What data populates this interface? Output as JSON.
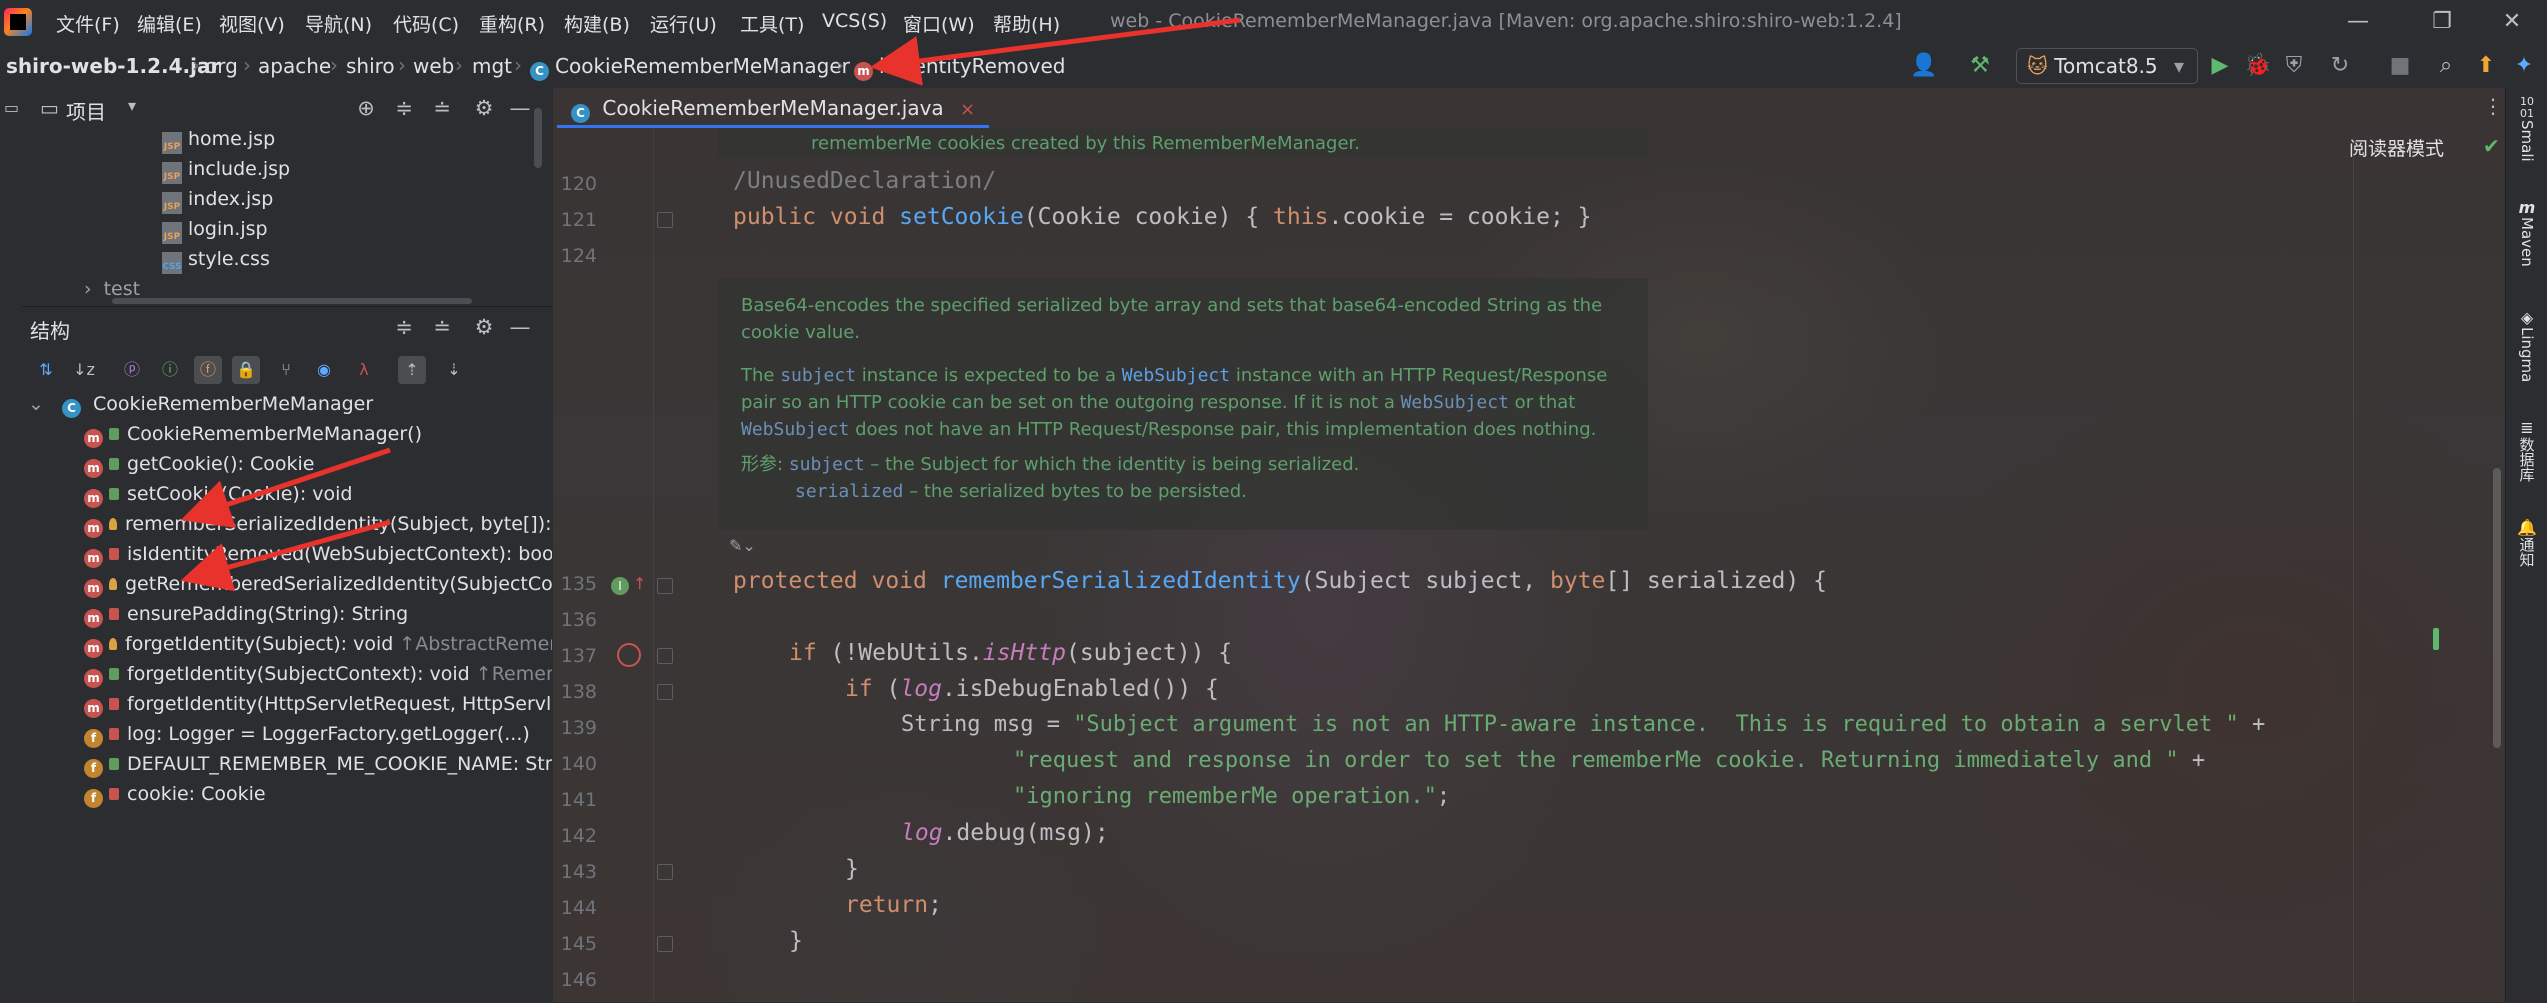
{
  "menu": [
    "文件(F)",
    "编辑(E)",
    "视图(V)",
    "导航(N)",
    "代码(C)",
    "重构(R)",
    "构建(B)",
    "运行(U)",
    "工具(T)",
    "VCS(S)",
    "窗口(W)",
    "帮助(H)"
  ],
  "window_title": "web - CookieRememberMeManager.java [Maven: org.apache.shiro:shiro-web:1.2.4]",
  "window_controls": {
    "minimize": "—",
    "restore": "❐",
    "close": "✕"
  },
  "breadcrumb": [
    "shiro-web-1.2.4.jar",
    "org",
    "apache",
    "shiro",
    "web",
    "mgt",
    "CookieRememberMeManager",
    "isIdentityRemoved"
  ],
  "run_config": "Tomcat8.5",
  "project_panel": {
    "title": "项目",
    "files": [
      {
        "name": "home.jsp",
        "type": "JSP"
      },
      {
        "name": "include.jsp",
        "type": "JSP"
      },
      {
        "name": "index.jsp",
        "type": "JSP"
      },
      {
        "name": "login.jsp",
        "type": "JSP"
      },
      {
        "name": "style.css",
        "type": "CSS"
      }
    ],
    "folder": "test"
  },
  "structure_panel": {
    "title": "结构",
    "root": "CookieRememberMeManager",
    "members": [
      {
        "kind": "m",
        "vis": "pub",
        "text": "CookieRememberMeManager()",
        "suffix": ""
      },
      {
        "kind": "m",
        "vis": "pub",
        "text": "getCookie(): Cookie",
        "suffix": ""
      },
      {
        "kind": "m",
        "vis": "pub",
        "text": "setCookie(Cookie): void",
        "suffix": ""
      },
      {
        "kind": "m",
        "vis": "prot",
        "text": "rememberSerializedIdentity(Subject, byte[]): v",
        "suffix": ""
      },
      {
        "kind": "m",
        "vis": "priv",
        "text": "isIdentityRemoved(WebSubjectContext): bool",
        "suffix": ""
      },
      {
        "kind": "m",
        "vis": "prot",
        "text": "getRememberedSerializedIdentity(SubjectCor",
        "suffix": ""
      },
      {
        "kind": "m",
        "vis": "priv",
        "text": "ensurePadding(String): String",
        "suffix": ""
      },
      {
        "kind": "m",
        "vis": "prot",
        "text": "forgetIdentity(Subject): void",
        "suffix": " ↑AbstractRememb"
      },
      {
        "kind": "m",
        "vis": "pub",
        "text": "forgetIdentity(SubjectContext): void",
        "suffix": " ↑Remem"
      },
      {
        "kind": "m",
        "vis": "priv",
        "text": "forgetIdentity(HttpServletRequest, HttpServle",
        "suffix": ""
      },
      {
        "kind": "f",
        "vis": "priv",
        "text": "log: Logger = LoggerFactory.getLogger(...)",
        "suffix": ""
      },
      {
        "kind": "f",
        "vis": "pub",
        "text": "DEFAULT_REMEMBER_ME_COOKIE_NAME: Str",
        "suffix": ""
      },
      {
        "kind": "f",
        "vis": "priv",
        "text": "cookie: Cookie",
        "suffix": ""
      }
    ]
  },
  "editor": {
    "tab": "CookieRememberMeManager.java",
    "reader_mode": "阅读器模式",
    "top_doc_fragment": "rememberMe cookies created by this RememberMeManager.",
    "doc": {
      "p1": "Base64-encodes the specified serialized byte array and sets that base64-encoded String as the cookie value.",
      "p2_a": "The ",
      "p2_code1": "subject",
      "p2_b": " instance is expected to be a ",
      "p2_link": "WebSubject",
      "p2_c": " instance with an HTTP Request/Response pair so an HTTP cookie can be set on the outgoing response. If it is not a ",
      "p2_code2": "WebSubject",
      "p2_d": " or that ",
      "p2_code3": "WebSubject",
      "p2_e": " does not have an HTTP Request/Response pair, this implementation does nothing.",
      "params_label": "形参:",
      "param1": "subject",
      "param1_desc": " – the Subject for which the identity is being serialized.",
      "param2": "serialized",
      "param2_desc": " – the serialized bytes to be persisted."
    },
    "lines": {
      "n120": "120",
      "n121": "121",
      "n124": "124",
      "n135": "135",
      "n136": "136",
      "n137": "137",
      "n138": "138",
      "n139": "139",
      "n140": "140",
      "n141": "141",
      "n142": "142",
      "n143": "143",
      "n144": "144",
      "n145": "145",
      "n146": "146"
    },
    "code": {
      "l120": "/UnusedDeclaration/",
      "l121_kw": "public void ",
      "l121_fn": "setCookie",
      "l121_rest": "(Cookie cookie) { ",
      "l121_this": "this",
      "l121_end": ".cookie = cookie; }",
      "l135_kw": "protected void ",
      "l135_fn": "rememberSerializedIdentity",
      "l135_a": "(Subject subject, ",
      "l135_kw2": "byte",
      "l135_b": "[] serialized) {",
      "l137_kw": "if ",
      "l137_a": "(!WebUtils.",
      "l137_it": "isHttp",
      "l137_b": "(subject)) {",
      "l138_kw": "if ",
      "l138_a": "(",
      "l138_it": "log",
      "l138_b": ".isDebugEnabled()) {",
      "l139_a": "String msg = ",
      "l139_str": "\"Subject argument is not an HTTP-aware instance.  This is required to obtain a servlet \"",
      "l139_b": " +",
      "l140_str": "\"request and response in order to set the rememberMe cookie. Returning immediately and \"",
      "l140_b": " +",
      "l141_str": "\"ignoring rememberMe operation.\"",
      "l141_b": ";",
      "l142_it": "log",
      "l142_b": ".debug(msg);",
      "l143": "}",
      "l144_kw": "return",
      "l144_b": ";",
      "l145": "}"
    }
  },
  "right_tools": [
    "Smali",
    "Maven",
    "Lingma",
    "数据库",
    "通知"
  ],
  "colors": {
    "accent": "#3574f0",
    "annotation_red": "#e8322c"
  }
}
